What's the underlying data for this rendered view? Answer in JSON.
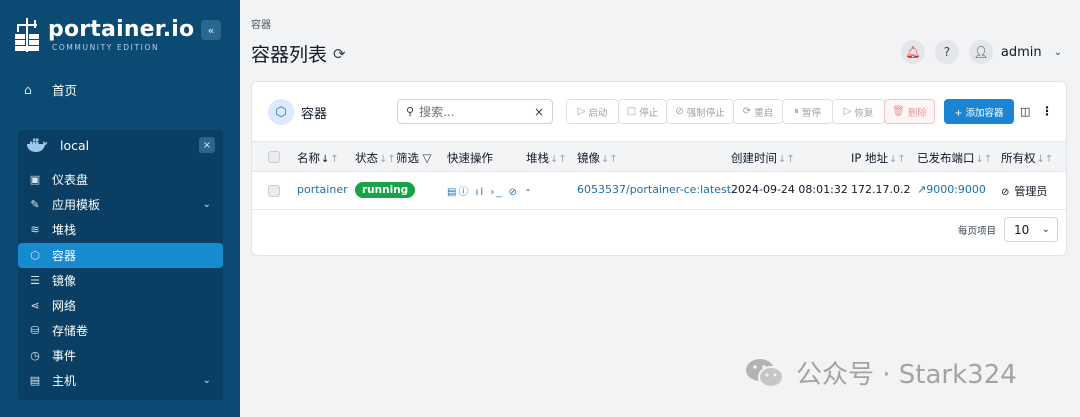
{
  "brand": {
    "name": "portainer.io",
    "edition": "COMMUNITY EDITION",
    "collapse": "«"
  },
  "sidebar": {
    "home_label": "首页",
    "environment": {
      "name": "local",
      "close": "×"
    },
    "items": [
      {
        "label": "仪表盘",
        "icon": "dashboard-icon"
      },
      {
        "label": "应用模板",
        "icon": "template-icon",
        "chevron": "⌄"
      },
      {
        "label": "堆栈",
        "icon": "stack-icon"
      },
      {
        "label": "容器",
        "icon": "container-icon",
        "active": true
      },
      {
        "label": "镜像",
        "icon": "image-icon"
      },
      {
        "label": "网络",
        "icon": "network-icon"
      },
      {
        "label": "存储卷",
        "icon": "volume-icon"
      },
      {
        "label": "事件",
        "icon": "clock-icon"
      },
      {
        "label": "主机",
        "icon": "host-icon",
        "chevron": "⌄"
      }
    ]
  },
  "header": {
    "breadcrumb": "容器",
    "title": "容器列表",
    "user": "admin"
  },
  "card": {
    "title": "容器",
    "search_placeholder": "搜索...",
    "actions": {
      "start": "启动",
      "stop": "停止",
      "kill": "强制停止",
      "restart": "重启",
      "pause": "暂停",
      "resume": "恢复",
      "remove": "删除",
      "add": "+ 添加容器"
    },
    "columns": {
      "name": "名称",
      "state": "状态",
      "filter": "筛选",
      "quick_actions": "快速操作",
      "stack": "堆栈",
      "image": "镜像",
      "created": "创建时间",
      "ip": "IP 地址",
      "ports": "已发布端口",
      "ownership": "所有权"
    },
    "rows": [
      {
        "name": "portainer",
        "state": "running",
        "quick_actions": "▤ⓘ ıl ›_ ⊘",
        "stack": "-",
        "image": "6053537/portainer-ce:latest",
        "created": "2024-09-24 08:01:32",
        "ip": "172.17.0.2",
        "ports": "9000:9000",
        "ownership": "管理员"
      }
    ],
    "pager": {
      "label": "每页项目",
      "value": "10"
    }
  },
  "watermark": {
    "text": "公众号 · Stark324"
  },
  "colors": {
    "sidebar": "#0b4a73",
    "accent": "#178bd0",
    "running": "#16a34a"
  }
}
